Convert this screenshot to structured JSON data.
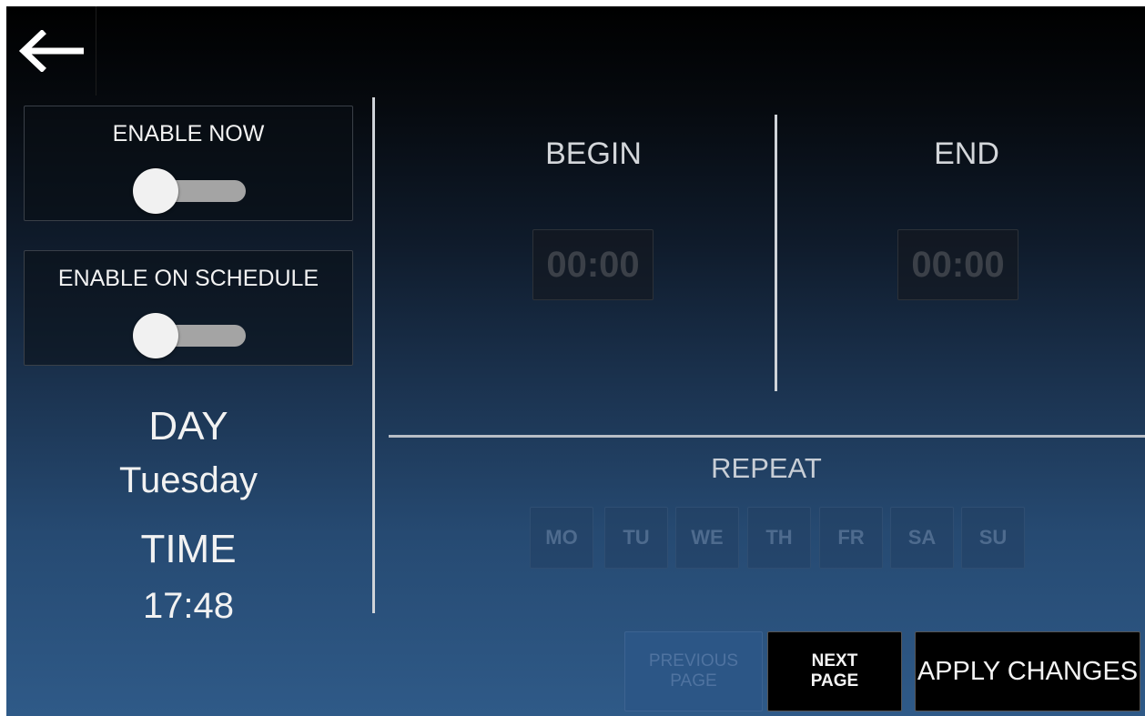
{
  "header": {
    "back_icon": "arrow-left-icon"
  },
  "left_panel": {
    "enable_now": {
      "label": "ENABLE NOW",
      "on": false
    },
    "enable_on_schedule": {
      "label": "ENABLE ON SCHEDULE",
      "on": false
    },
    "day_label": "DAY",
    "day_value": "Tuesday",
    "time_label": "TIME",
    "time_value": "17:48"
  },
  "schedule": {
    "begin_label": "BEGIN",
    "begin_time": "00:00",
    "end_label": "END",
    "end_time": "00:00"
  },
  "repeat": {
    "title": "REPEAT",
    "days": [
      "MO",
      "TU",
      "WE",
      "TH",
      "FR",
      "SA",
      "SU"
    ]
  },
  "footer": {
    "prev_line1": "PREVIOUS",
    "prev_line2": "PAGE",
    "next_line1": "NEXT",
    "next_line2": "PAGE",
    "apply": "APPLY CHANGES"
  },
  "colors": {
    "toggle_track": "#a4a4a4",
    "toggle_knob": "#f1f1f1",
    "disabled_text": "#3b4048",
    "day_button_text": "#4e6b8e"
  }
}
